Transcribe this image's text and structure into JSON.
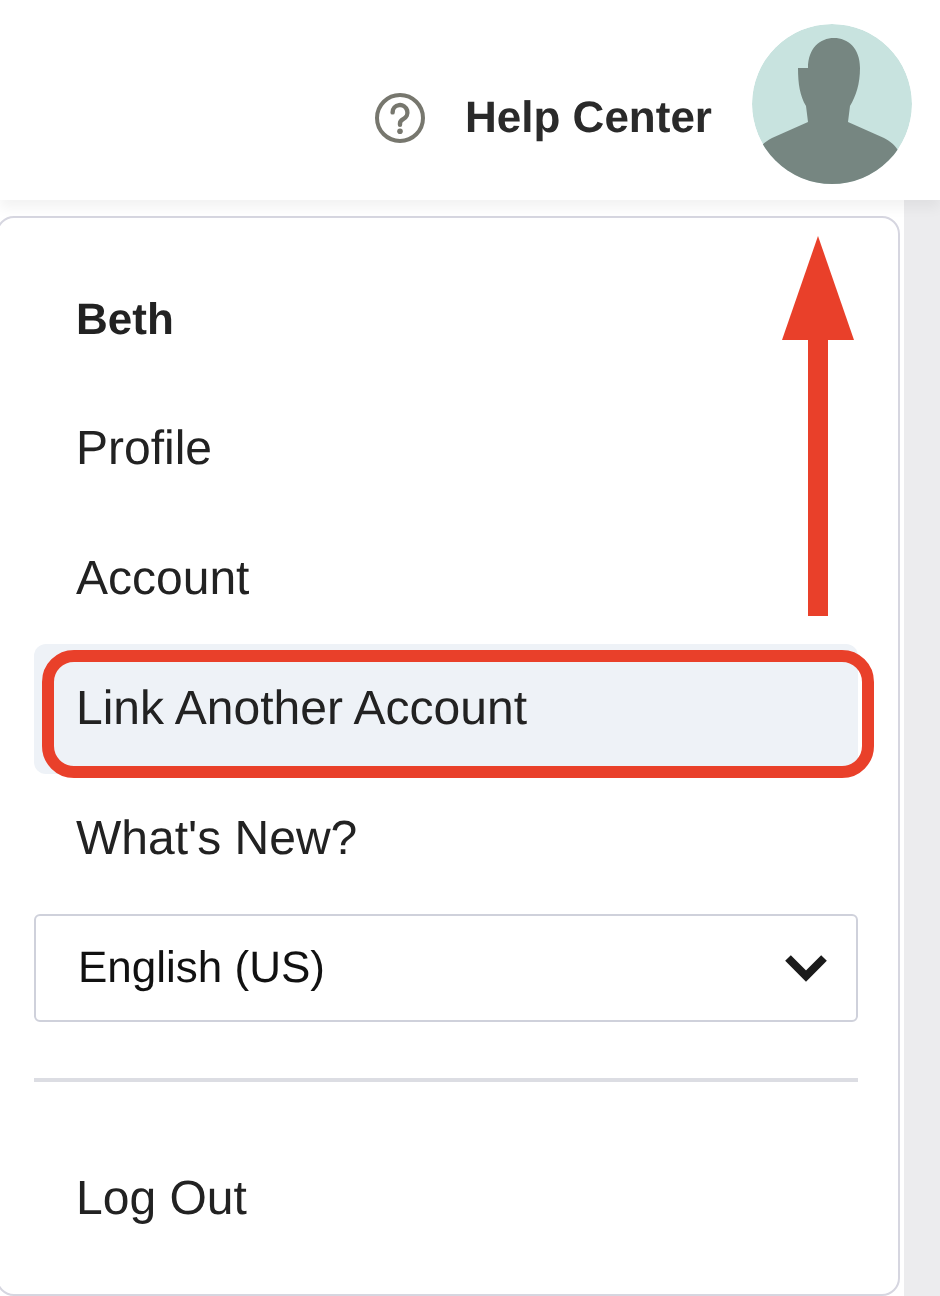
{
  "header": {
    "help_label": "Help Center"
  },
  "menu": {
    "items": [
      {
        "kind": "name",
        "label": "Beth"
      },
      {
        "kind": "link",
        "label": "Profile",
        "selected": false,
        "highlighted": false
      },
      {
        "kind": "link",
        "label": "Account",
        "selected": false,
        "highlighted": false
      },
      {
        "kind": "link",
        "label": "Link Another Account",
        "selected": true,
        "highlighted": true
      },
      {
        "kind": "link",
        "label": "What's New?",
        "selected": false,
        "highlighted": false
      },
      {
        "kind": "select",
        "label": "English (US)"
      },
      {
        "kind": "divider"
      },
      {
        "kind": "link",
        "label": "Log Out",
        "selected": false,
        "highlighted": false
      }
    ]
  }
}
